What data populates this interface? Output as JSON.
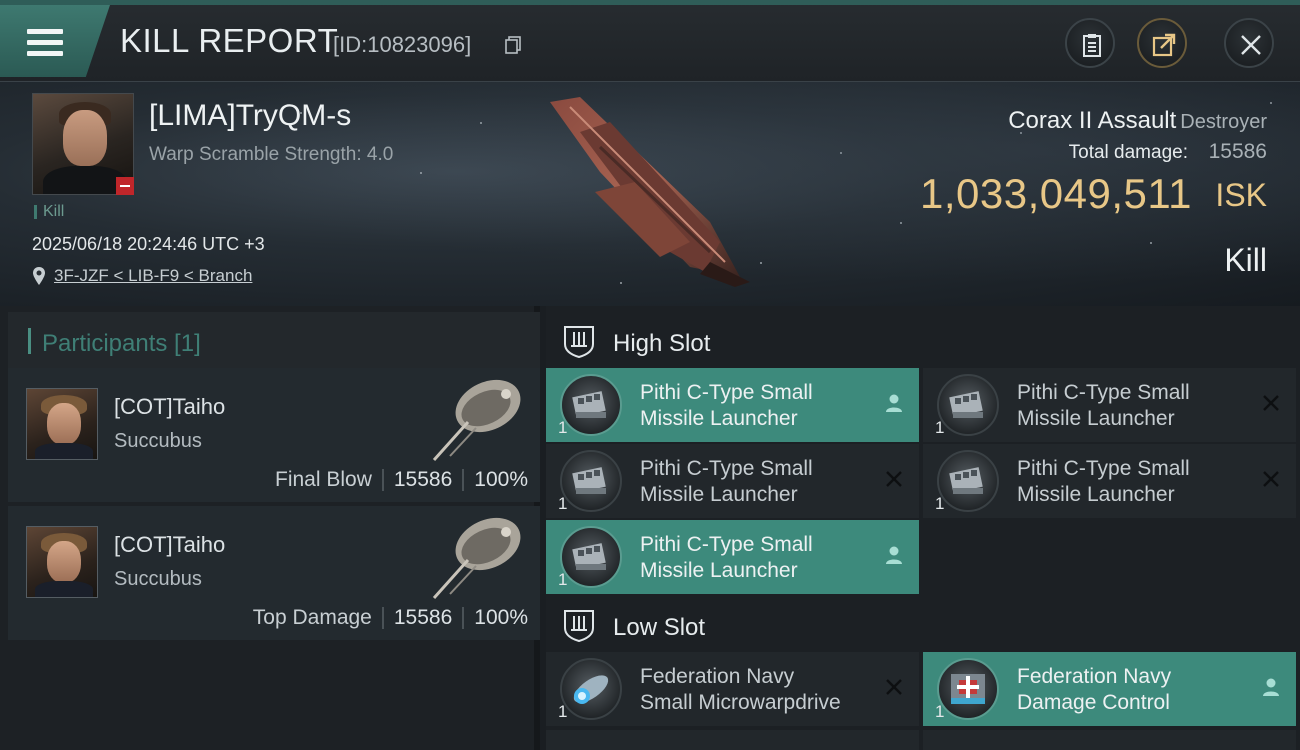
{
  "header": {
    "title": "KILL REPORT",
    "report_id": "[ID:10823096]"
  },
  "victim": {
    "name": "[LIMA]TryQM-s",
    "warp_scramble": "Warp Scramble Strength: 4.0",
    "kill_tag": "Kill",
    "timestamp": "2025/06/18 20:24:46 UTC +3",
    "location": "3F-JZF < LIB-F9 < Branch",
    "ship_name": "Corax II Assault",
    "ship_class": "Destroyer",
    "total_damage_label": "Total damage:",
    "total_damage": "15586",
    "isk_value": "1,033,049,511",
    "isk_unit": "ISK",
    "result": "Kill"
  },
  "participants": {
    "title": "Participants [1]",
    "items": [
      {
        "name": "[COT]Taiho",
        "ship": "Succubus",
        "role": "Final Blow",
        "damage": "15586",
        "percent": "100%"
      },
      {
        "name": "[COT]Taiho",
        "ship": "Succubus",
        "role": "Top Damage",
        "damage": "15586",
        "percent": "100%"
      }
    ]
  },
  "fitting": {
    "high_slot_title": "High Slot",
    "low_slot_title": "Low Slot",
    "high_modules": [
      {
        "line1": "Pithi C-Type Small",
        "line2": "Missile Launcher",
        "qty": "1",
        "status": "person-icon"
      },
      {
        "line1": "Pithi C-Type Small",
        "line2": "Missile Launcher",
        "qty": "1",
        "status": "close-icon"
      },
      {
        "line1": "Pithi C-Type Small",
        "line2": "Missile Launcher",
        "qty": "1",
        "status": "close-icon"
      },
      {
        "line1": "Pithi C-Type Small",
        "line2": "Missile Launcher",
        "qty": "1",
        "status": "close-icon"
      },
      {
        "line1": "Pithi C-Type Small",
        "line2": "Missile Launcher",
        "qty": "1",
        "status": "person-icon"
      }
    ],
    "low_modules": [
      {
        "line1": "Federation Navy",
        "line2": "Small Microwarpdrive",
        "qty": "1",
        "status": "close-icon"
      },
      {
        "line1": "Federation Navy",
        "line2": "Damage Control",
        "qty": "1",
        "status": "person-icon"
      }
    ]
  },
  "colors": {
    "accent_teal": "#3d8a7c",
    "isk_gold": "#e8c787",
    "alert_red": "#c0262a"
  }
}
